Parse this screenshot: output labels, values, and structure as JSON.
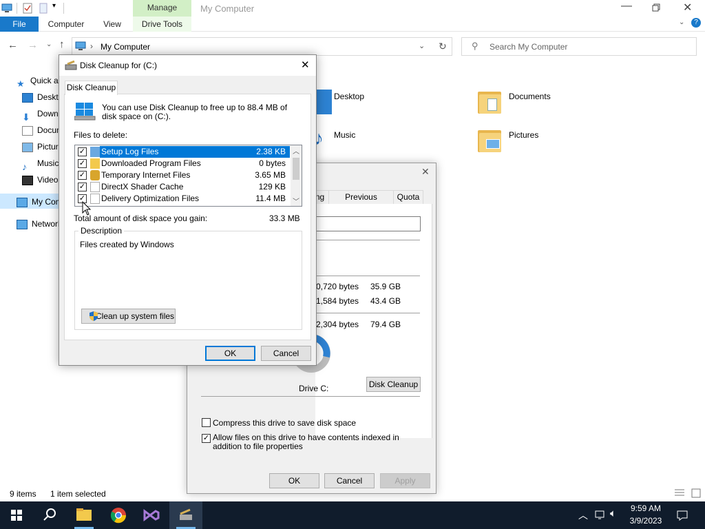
{
  "explorer": {
    "window_title": "My Computer",
    "manage_tab": "Manage",
    "ribbon_tabs": {
      "file": "File",
      "computer": "Computer",
      "view": "View",
      "drive_tools": "Drive Tools"
    },
    "address": "My Computer",
    "search_placeholder": "Search My Computer",
    "nav": [
      {
        "label": "Quick access",
        "icon": "star-icon"
      },
      {
        "label": "Desktop",
        "icon": "desktop-icon"
      },
      {
        "label": "Downloads",
        "icon": "download-icon"
      },
      {
        "label": "Documents",
        "icon": "documents-icon"
      },
      {
        "label": "Pictures",
        "icon": "pictures-icon"
      },
      {
        "label": "Music",
        "icon": "music-icon"
      },
      {
        "label": "Videos",
        "icon": "videos-icon"
      },
      {
        "label": "My Computer",
        "icon": "computer-icon"
      },
      {
        "label": "Network",
        "icon": "network-icon"
      }
    ],
    "folders": [
      {
        "label": "Desktop"
      },
      {
        "label": "Documents"
      },
      {
        "label": "Music"
      },
      {
        "label": "Pictures"
      }
    ],
    "status": {
      "items": "9 items",
      "selected": "1 item selected"
    }
  },
  "properties": {
    "tabs": {
      "sharing_partial": "ng",
      "previous_versions": "Previous Versions",
      "quota": "Quota"
    },
    "used_bytes": "0,720 bytes",
    "used_gb": "35.9 GB",
    "free_bytes": "1,584 bytes",
    "free_gb": "43.4 GB",
    "cap_bytes": "2,304 bytes",
    "cap_gb": "79.4 GB",
    "drive_label": "Drive C:",
    "disk_cleanup_btn": "Disk Cleanup",
    "compress_label": "Compress this drive to save disk space",
    "index_label": "Allow files on this drive to have contents indexed in addition to file properties",
    "ok": "OK",
    "cancel": "Cancel",
    "apply": "Apply"
  },
  "disk_cleanup": {
    "title": "Disk Cleanup for  (C:)",
    "tab": "Disk Cleanup",
    "intro": "You can use Disk Cleanup to free up to 88.4 MB of disk space on  (C:).",
    "files_to_delete": "Files to delete:",
    "items": [
      {
        "name": "Setup Log Files",
        "size": "2.38 KB",
        "checked": true
      },
      {
        "name": "Downloaded Program Files",
        "size": "0 bytes",
        "checked": true
      },
      {
        "name": "Temporary Internet Files",
        "size": "3.65 MB",
        "checked": true
      },
      {
        "name": "DirectX Shader Cache",
        "size": "129 KB",
        "checked": true
      },
      {
        "name": "Delivery Optimization Files",
        "size": "11.4 MB",
        "checked": true
      }
    ],
    "total_label": "Total amount of disk space you gain:",
    "total_value": "33.3 MB",
    "description_label": "Description",
    "description_text": "Files created by Windows",
    "cleanup_system_btn": "Clean up system files",
    "ok": "OK",
    "cancel": "Cancel"
  },
  "taskbar": {
    "time": "9:59 AM",
    "date": "3/9/2023"
  },
  "colors": {
    "accent": "#0078d7",
    "file_tab": "#1979ca",
    "taskbar": "#101c2c",
    "manage": "#d2efc6"
  }
}
